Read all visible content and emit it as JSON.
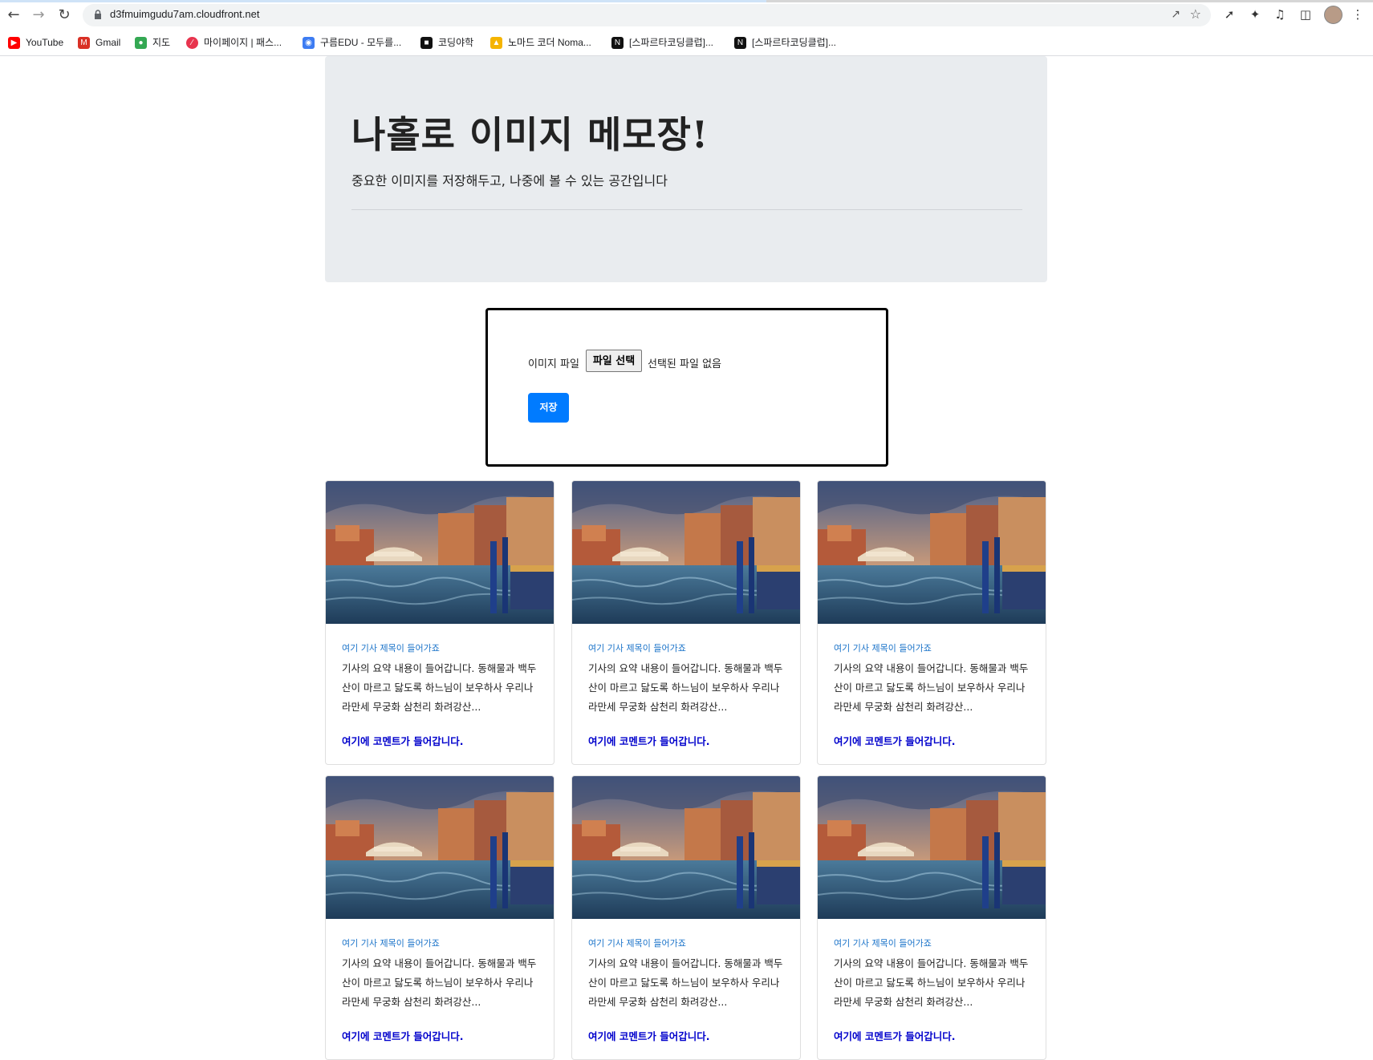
{
  "browser": {
    "url": "d3fmuimgudu7am.cloudfront.net",
    "bookmarks": [
      {
        "label": "YouTube",
        "icon": "youtube-icon",
        "color": "#ff0000"
      },
      {
        "label": "Gmail",
        "icon": "gmail-icon",
        "color": "#d93025"
      },
      {
        "label": "지도",
        "icon": "maps-icon",
        "color": "#34a853"
      },
      {
        "label": "마이페이지 | 패스...",
        "icon": "fastcampus-icon",
        "color": "#e8344e"
      },
      {
        "label": "구름EDU - 모두를...",
        "icon": "goorm-icon",
        "color": "#3d7cf2"
      },
      {
        "label": "코딩야학",
        "icon": "codingyahak-icon",
        "color": "#111111"
      },
      {
        "label": "노마드 코더 Noma...",
        "icon": "nomadcoder-icon",
        "color": "#f5b400"
      },
      {
        "label": "[스파르타코딩클럽]...",
        "icon": "notion-icon",
        "color": "#111111"
      },
      {
        "label": "[스파르타코딩클럽]...",
        "icon": "notion-icon",
        "color": "#111111"
      }
    ]
  },
  "header": {
    "title": "나홀로 이미지 메모장!",
    "lead": "중요한 이미지를 저장해두고, 나중에 볼 수 있는 공간입니다"
  },
  "upload": {
    "label": "이미지 파일",
    "file_button": "파일 선택",
    "no_file": "선택된 파일 없음",
    "save_button": "저장"
  },
  "cards": [
    {
      "title": "여기 기사 제목이 들어가죠",
      "summary": "기사의 요약 내용이 들어갑니다. 동해물과 백두산이 마르고 닳도록 하느님이 보우하사 우리나라만세 무궁화 삼천리 화려강산...",
      "comment": "여기에 코멘트가 들어갑니다."
    },
    {
      "title": "여기 기사 제목이 들어가죠",
      "summary": "기사의 요약 내용이 들어갑니다. 동해물과 백두산이 마르고 닳도록 하느님이 보우하사 우리나라만세 무궁화 삼천리 화려강산...",
      "comment": "여기에 코멘트가 들어갑니다."
    },
    {
      "title": "여기 기사 제목이 들어가죠",
      "summary": "기사의 요약 내용이 들어갑니다. 동해물과 백두산이 마르고 닳도록 하느님이 보우하사 우리나라만세 무궁화 삼천리 화려강산...",
      "comment": "여기에 코멘트가 들어갑니다."
    },
    {
      "title": "여기 기사 제목이 들어가죠",
      "summary": "기사의 요약 내용이 들어갑니다. 동해물과 백두산이 마르고 닳도록 하느님이 보우하사 우리나라만세 무궁화 삼천리 화려강산...",
      "comment": "여기에 코멘트가 들어갑니다."
    },
    {
      "title": "여기 기사 제목이 들어가죠",
      "summary": "기사의 요약 내용이 들어갑니다. 동해물과 백두산이 마르고 닳도록 하느님이 보우하사 우리나라만세 무궁화 삼천리 화려강산...",
      "comment": "여기에 코멘트가 들어갑니다."
    },
    {
      "title": "여기 기사 제목이 들어가죠",
      "summary": "기사의 요약 내용이 들어갑니다. 동해물과 백두산이 마르고 닳도록 하느님이 보우하사 우리나라만세 무궁화 삼천리 화려강산...",
      "comment": "여기에 코멘트가 들어갑니다."
    }
  ],
  "colors": {
    "primary": "#007bff",
    "card_title": "#1a73c9",
    "comment": "#0000cc",
    "jumbotron_bg": "#e9ecef"
  }
}
